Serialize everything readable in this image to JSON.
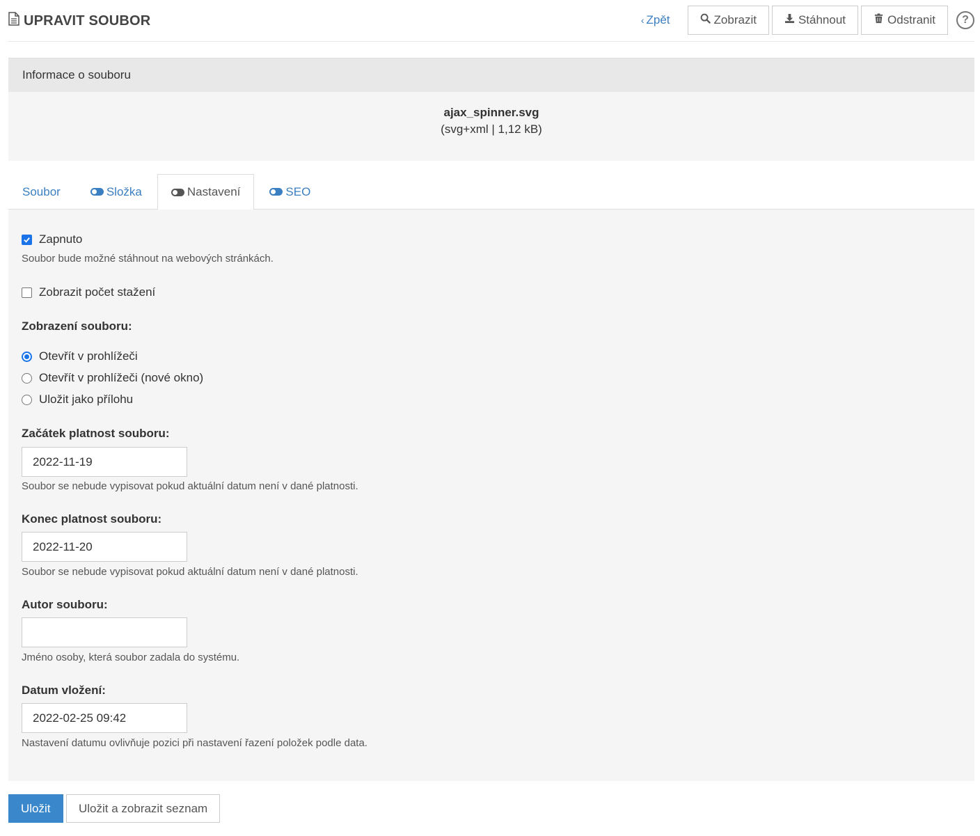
{
  "header": {
    "title": "UPRAVIT SOUBOR",
    "back_label": "Zpět",
    "view_label": "Zobrazit",
    "download_label": "Stáhnout",
    "delete_label": "Odstranit",
    "help_label": "?"
  },
  "info": {
    "heading": "Informace o souboru",
    "file_name": "ajax_spinner.svg",
    "file_meta": "(svg+xml | 1,12 kB)"
  },
  "tabs": [
    {
      "label": "Soubor",
      "active": false
    },
    {
      "label": "Složka",
      "active": false
    },
    {
      "label": "Nastavení",
      "active": true
    },
    {
      "label": "SEO",
      "active": false
    }
  ],
  "form": {
    "enabled_label": "Zapnuto",
    "enabled_checked": true,
    "enabled_help": "Soubor bude možné stáhnout na webových stránkách.",
    "show_count_label": "Zobrazit počet stažení",
    "show_count_checked": false,
    "display_label": "Zobrazení souboru:",
    "display_options": [
      {
        "label": "Otevřít v prohlížeči",
        "checked": true
      },
      {
        "label": "Otevřít v prohlížeči (nové okno)",
        "checked": false
      },
      {
        "label": "Uložit jako přílohu",
        "checked": false
      }
    ],
    "start_label": "Začátek platnost souboru:",
    "start_value": "2022-11-19",
    "start_help": "Soubor se nebude vypisovat pokud aktuální datum není v dané platnosti.",
    "end_label": "Konec platnost souboru:",
    "end_value": "2022-11-20",
    "end_help": "Soubor se nebude vypisovat pokud aktuální datum není v dané platnosti.",
    "author_label": "Autor souboru:",
    "author_value": "",
    "author_help": "Jméno osoby, která soubor zadala do systému.",
    "date_label": "Datum vložení:",
    "date_value": "2022-02-25 09:42",
    "date_help": "Nastavení datumu ovlivňuje pozici při nastavení řazení položek podle data."
  },
  "actions": {
    "save_label": "Uložit",
    "save_list_label": "Uložit a zobrazit seznam"
  },
  "colors": {
    "accent": "#3a7fc1",
    "primary_button": "#3a87cc",
    "checkbox": "#1a73e8"
  }
}
